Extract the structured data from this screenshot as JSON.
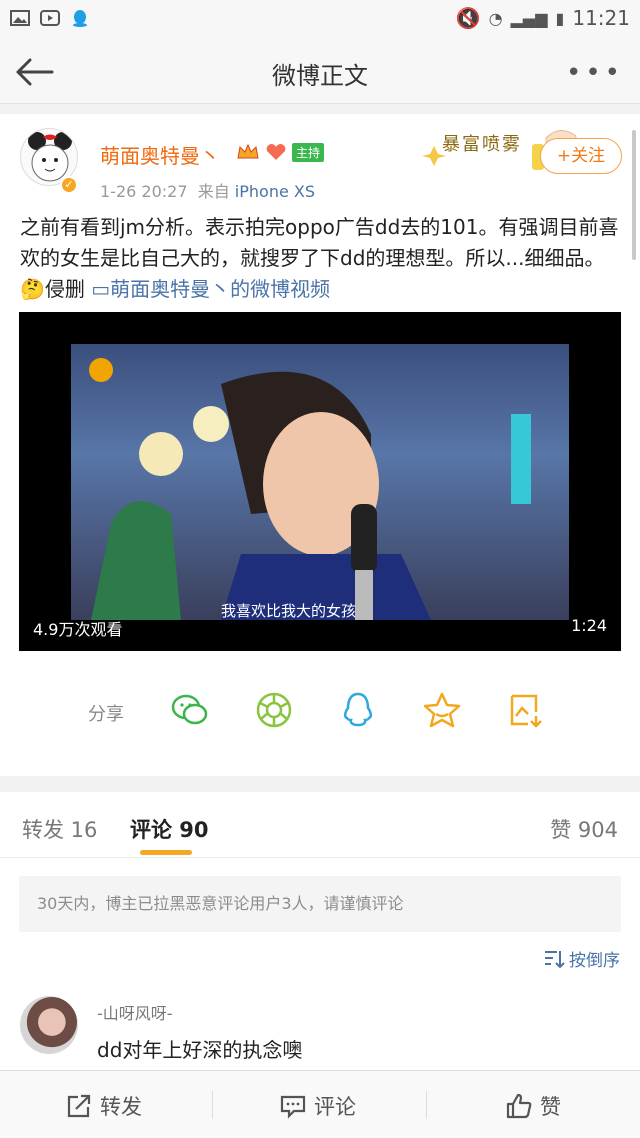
{
  "status_bar": {
    "time": "11:21"
  },
  "nav": {
    "title": "微博正文",
    "more": "•••"
  },
  "post": {
    "username": "萌面奥特曼丶",
    "host_badge": "主持",
    "date": "1-26 20:27",
    "source_prefix": "来自",
    "source": "iPhone XS",
    "decoration_text": "暴富喷雾",
    "follow_label": "+关注",
    "body_text": "之前有看到jm分析。表示拍完oppo广告dd去的101。有强调目前喜欢的女生是比自己大的，就搜罗了下dd的理想型。所以...细细品。",
    "body_emoji_text": "侵删",
    "video_link_text": "萌面奥特曼丶的微博视频",
    "video": {
      "caption": "我喜欢比我大的女孩",
      "views": "4.9万次观看",
      "duration": "1:24"
    },
    "share_label": "分享"
  },
  "tabs": {
    "repost": "转发 16",
    "comment": "评论 90",
    "like": "赞 904"
  },
  "comments": {
    "notice": "30天内，博主已拉黑恶意评论用户3人，请谨慎评论",
    "sort_label": "按倒序",
    "items": [
      {
        "name": "-山呀风呀-",
        "text": "dd对年上好深的执念噢"
      }
    ]
  },
  "bottom_bar": {
    "repost": "转发",
    "comment": "评论",
    "like": "赞"
  },
  "colors": {
    "accent_orange": "#f17a17",
    "link_blue": "#4a73a6",
    "tab_underline": "#f5a623"
  }
}
